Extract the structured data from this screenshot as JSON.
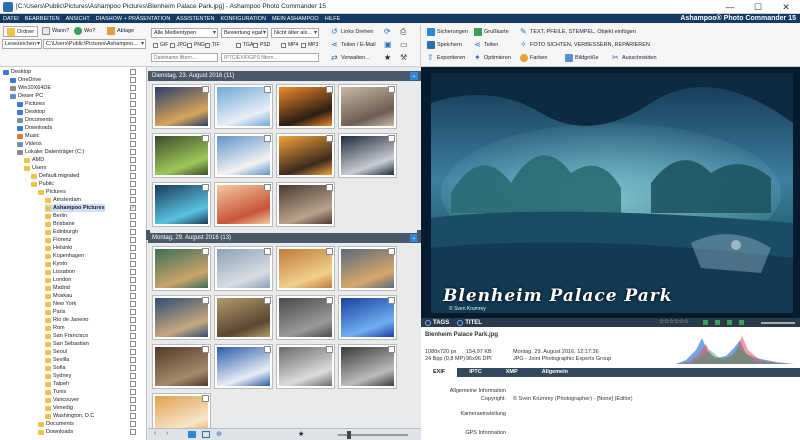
{
  "window": {
    "title": "[C:\\Users\\Public\\Pictures\\Ashampoo Pictures\\Blenheim Palace Park.jpg] - Ashampoo Photo Commander 15",
    "min": "—",
    "max": "☐",
    "close": "✕"
  },
  "menu": {
    "items": [
      "DATEI",
      "BEARBEITEN",
      "ANSICHT",
      "DIASHOW + PRÄSENTATION",
      "ASSISTENTEN",
      "KONFIGURATION",
      "MEIN ASHAMPOO",
      "HILFE"
    ],
    "brand": "Ashampoo® Photo Commander 15"
  },
  "toolbar": {
    "nav": {
      "ordner": "Ordner",
      "wann": "Wann?",
      "wo": "Wo?",
      "ablage": "Ablage",
      "lesezeichen": "Lesezeichen",
      "path": "C:\\Users\\Public\\Pictures\\Ashampoo..."
    },
    "filter": {
      "media": "Alle Medientypen",
      "rating": "Bewertung egal",
      "age": "Nicht älter als...",
      "formats": [
        "GIF",
        "JPG",
        "PNG",
        "TIF",
        "TGA",
        "PSD",
        "MP4",
        "MP3"
      ],
      "filename_placeholder": "Dateiname filtern...",
      "iptc_placeholder": "IPTC/EXIF/GPS filtern..."
    },
    "actions": {
      "rotate_left": "Links Drehen",
      "share_email": "Teilen / E-Mail",
      "manage": "Verwalten..."
    },
    "edit": {
      "backup": "Sicherungen",
      "grusskarte": "Grußkarte",
      "text": "TEXT, PFEILE, STEMPEL, Objekt einfügen",
      "save": "Speichern",
      "share": "Teilen",
      "fix": "FOTO SICHTEN, VERBESSERN, REPARIEREN",
      "export": "Exportieren",
      "optimize": "Optimieren",
      "colors": "Farben",
      "resize": "Bildgröße",
      "crop": "Ausschneiden"
    }
  },
  "tree": [
    {
      "label": "Desktop",
      "level": 0,
      "color": "#3a7bd5"
    },
    {
      "label": "OneDrive",
      "level": 1,
      "color": "#3a7bd5"
    },
    {
      "label": "Win10X64DE",
      "level": 1,
      "color": "#8a8a8a"
    },
    {
      "label": "Dieser PC",
      "level": 1,
      "color": "#5a8ed0"
    },
    {
      "label": "Pictures",
      "level": 2,
      "color": "#3a7bd5"
    },
    {
      "label": "Desktop",
      "level": 2,
      "color": "#3a7bd5"
    },
    {
      "label": "Documents",
      "level": 2,
      "color": "#7a8fa8"
    },
    {
      "label": "Downloads",
      "level": 2,
      "color": "#3a7bd5"
    },
    {
      "label": "Music",
      "level": 2,
      "color": "#e07c3a"
    },
    {
      "label": "Videos",
      "level": 2,
      "color": "#7a8fa8"
    },
    {
      "label": "Lokaler Datenträger (C:)",
      "level": 2,
      "color": "#8a8a8a"
    },
    {
      "label": "AMD",
      "level": 3,
      "color": "#f0c24a"
    },
    {
      "label": "Users",
      "level": 3,
      "color": "#f0c24a"
    },
    {
      "label": "Default.migrated",
      "level": 4,
      "color": "#f0c24a"
    },
    {
      "label": "Public",
      "level": 4,
      "color": "#f0c24a"
    },
    {
      "label": "Pictures",
      "level": 5,
      "color": "#f0c24a"
    },
    {
      "label": "Amsterdam",
      "level": 6,
      "color": "#f0c24a"
    },
    {
      "label": "Ashampoo Pictures",
      "level": 6,
      "color": "#f0c24a",
      "selected": true,
      "checked": true
    },
    {
      "label": "Berlin",
      "level": 6,
      "color": "#f0c24a"
    },
    {
      "label": "Brisbane",
      "level": 6,
      "color": "#f0c24a"
    },
    {
      "label": "Edinburgh",
      "level": 6,
      "color": "#f0c24a"
    },
    {
      "label": "Florenz",
      "level": 6,
      "color": "#f0c24a"
    },
    {
      "label": "Helsinki",
      "level": 6,
      "color": "#f0c24a"
    },
    {
      "label": "Kopenhagen",
      "level": 6,
      "color": "#f0c24a"
    },
    {
      "label": "Kyoto",
      "level": 6,
      "color": "#f0c24a"
    },
    {
      "label": "Lissabon",
      "level": 6,
      "color": "#f0c24a"
    },
    {
      "label": "London",
      "level": 6,
      "color": "#f0c24a"
    },
    {
      "label": "Madrid",
      "level": 6,
      "color": "#f0c24a"
    },
    {
      "label": "Moskau",
      "level": 6,
      "color": "#f0c24a"
    },
    {
      "label": "New York",
      "level": 6,
      "color": "#f0c24a"
    },
    {
      "label": "Paris",
      "level": 6,
      "color": "#f0c24a"
    },
    {
      "label": "Rio de Janeiro",
      "level": 6,
      "color": "#f0c24a"
    },
    {
      "label": "Rom",
      "level": 6,
      "color": "#f0c24a"
    },
    {
      "label": "San Francisco",
      "level": 6,
      "color": "#f0c24a"
    },
    {
      "label": "San Sebastian",
      "level": 6,
      "color": "#f0c24a"
    },
    {
      "label": "Seoul",
      "level": 6,
      "color": "#f0c24a"
    },
    {
      "label": "Sevilla",
      "level": 6,
      "color": "#f0c24a"
    },
    {
      "label": "Sofia",
      "level": 6,
      "color": "#f0c24a"
    },
    {
      "label": "Sydney",
      "level": 6,
      "color": "#f0c24a"
    },
    {
      "label": "Taipeh",
      "level": 6,
      "color": "#f0c24a"
    },
    {
      "label": "Tunis",
      "level": 6,
      "color": "#f0c24a"
    },
    {
      "label": "Vancouver",
      "level": 6,
      "color": "#f0c24a"
    },
    {
      "label": "Venedig",
      "level": 6,
      "color": "#f0c24a"
    },
    {
      "label": "Washington, D.C",
      "level": 6,
      "color": "#f0c24a"
    },
    {
      "label": "Documents",
      "level": 5,
      "color": "#f0c24a"
    },
    {
      "label": "Downloads",
      "level": 5,
      "color": "#f0c24a"
    }
  ],
  "groups": [
    {
      "title": "Dienstag, 23. August 2016 (11)",
      "thumbs": [
        [
          "#2a3f6b",
          "#d7a55c"
        ],
        [
          "#6fa8d9",
          "#e8eef5"
        ],
        [
          "#f08a2a",
          "#2b1d14"
        ],
        [
          "#c9b8a4",
          "#6b5e52"
        ],
        [
          "#3c4b2a",
          "#9ec85a"
        ],
        [
          "#5f93c9",
          "#f2f2f2"
        ],
        [
          "#f3a33a",
          "#3c2a1e"
        ],
        [
          "#1f2a3a",
          "#c9cdd4"
        ],
        [
          "#1b3b5a",
          "#59c3e0"
        ],
        [
          "#f4c9a0",
          "#c6543a"
        ],
        [
          "#4a3a30",
          "#b9a38c"
        ]
      ]
    },
    {
      "title": "Montag, 29. August 2016 (13)",
      "thumbs": [
        [
          "#3e6f56",
          "#c9a46a"
        ],
        [
          "#8aa1b8",
          "#d9dde3"
        ],
        [
          "#c07a3a",
          "#f0d08a"
        ],
        [
          "#5a6a7a",
          "#d6a86b"
        ],
        [
          "#2f4e72",
          "#c5a880"
        ],
        [
          "#b39a6b",
          "#5a4632"
        ],
        [
          "#4a4a4a",
          "#9a9a9a"
        ],
        [
          "#1a3fa0",
          "#6fb0f0"
        ],
        [
          "#503a2a",
          "#a58a6a"
        ],
        [
          "#2a5aa8",
          "#e8eef5"
        ],
        [
          "#6a6a6a",
          "#dcdcdc"
        ],
        [
          "#3a3a3a",
          "#bcbcbc"
        ],
        [
          "#e0a050",
          "#f7e6c8"
        ]
      ]
    }
  ],
  "preview": {
    "caption": "Blenheim Palace Park",
    "credit": "© Sven Krumrey"
  },
  "tagsbar": {
    "tags": "TAGS",
    "title": "TITEL",
    "stars": "☆☆☆☆☆☆"
  },
  "info": {
    "filename": "Blenheim Palace Park.jpg",
    "dims": "1080x720 px",
    "size": "154,97 KB",
    "date": "Montag, 29. August 2016, 12:17:36",
    "bpp": "24 Bpp (0,8 MP)",
    "dpi": "96x96 DPI",
    "type": "JPG - Joint Photographic Experts Group",
    "tabs": [
      "EXIF",
      "IPTC",
      "XMP",
      "Allgemein"
    ],
    "rows": [
      {
        "label": "Allgemeine Information",
        "value": ""
      },
      {
        "label": "Copyright:",
        "value": "© Sven Krumrey (Photographer) - [None] (Editor)"
      },
      {
        "label": "Kameraeinstellung",
        "value": ""
      },
      {
        "label": "GPS Information",
        "value": ""
      }
    ]
  }
}
